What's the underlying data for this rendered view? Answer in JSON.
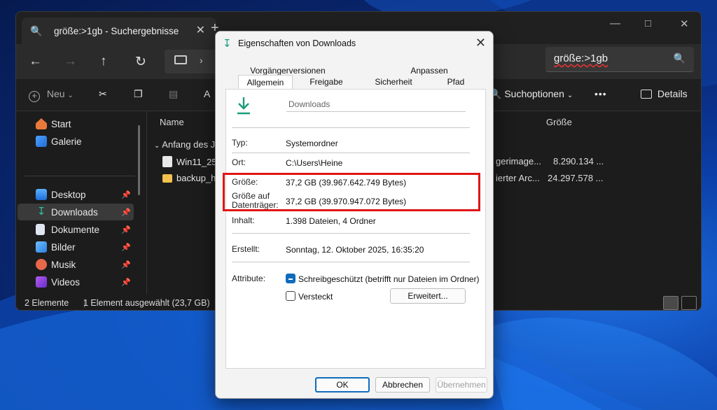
{
  "explorer": {
    "tab_title": "größe:>1gb - Suchergebnisse",
    "search_query": "größe:>1gb",
    "toolbar": {
      "new_label": "Neu",
      "search_options_label": "Suchoptionen",
      "more_label": "•••",
      "details_label": "Details"
    },
    "sidebar": {
      "top_items": [
        {
          "label": "Start",
          "icon": "home-icon"
        },
        {
          "label": "Galerie",
          "icon": "gallery-icon"
        }
      ],
      "pinned_items": [
        {
          "label": "Desktop",
          "icon": "desktop-icon"
        },
        {
          "label": "Downloads",
          "icon": "download-icon"
        },
        {
          "label": "Dokumente",
          "icon": "documents-icon"
        },
        {
          "label": "Bilder",
          "icon": "pictures-icon"
        },
        {
          "label": "Musik",
          "icon": "music-icon"
        },
        {
          "label": "Videos",
          "icon": "videos-icon"
        }
      ]
    },
    "file_list": {
      "col_name": "Name",
      "col_size": "Größe",
      "group_label": "Anfang des Ja",
      "rows": [
        {
          "name": "Win11_25H",
          "type": "gerimage...",
          "size": "8.290.134 ..."
        },
        {
          "name": "backup_he",
          "type": "ierter Arc...",
          "size": "24.297.578 ..."
        }
      ]
    },
    "status": {
      "count": "2 Elemente",
      "selection": "1 Element ausgewählt (23,7 GB)"
    }
  },
  "dialog": {
    "title": "Eigenschaften von Downloads",
    "tabs_row1": [
      "Vorgängerversionen",
      "Anpassen"
    ],
    "tabs_row2": [
      "Allgemein",
      "Freigabe",
      "Sicherheit",
      "Pfad"
    ],
    "name_value": "Downloads",
    "fields": {
      "typ_label": "Typ:",
      "typ_value": "Systemordner",
      "ort_label": "Ort:",
      "ort_value": "C:\\Users\\Heine",
      "groesse_label": "Größe:",
      "groesse_value": "37,2 GB (39.967.642.749 Bytes)",
      "groesse_auf_label_1": "Größe auf",
      "groesse_auf_label_2": "Datenträger:",
      "groesse_auf_value": "37,2 GB (39.970.947.072 Bytes)",
      "inhalt_label": "Inhalt:",
      "inhalt_value": "1.398 Dateien, 4 Ordner",
      "erstellt_label": "Erstellt:",
      "erstellt_value": "Sonntag, 12. Oktober 2025, 16:35:20",
      "attribute_label": "Attribute:",
      "readonly_label": "Schreibgeschützt (betrifft nur Dateien im Ordner)",
      "hidden_label": "Versteckt",
      "advanced_button": "Erweitert..."
    },
    "buttons": {
      "ok": "OK",
      "cancel": "Abbrechen",
      "apply": "Übernehmen"
    }
  },
  "colors": {
    "highlight_box": "#e01515",
    "accent": "#0f6cbd",
    "download_icon": "#1a9b7a"
  }
}
